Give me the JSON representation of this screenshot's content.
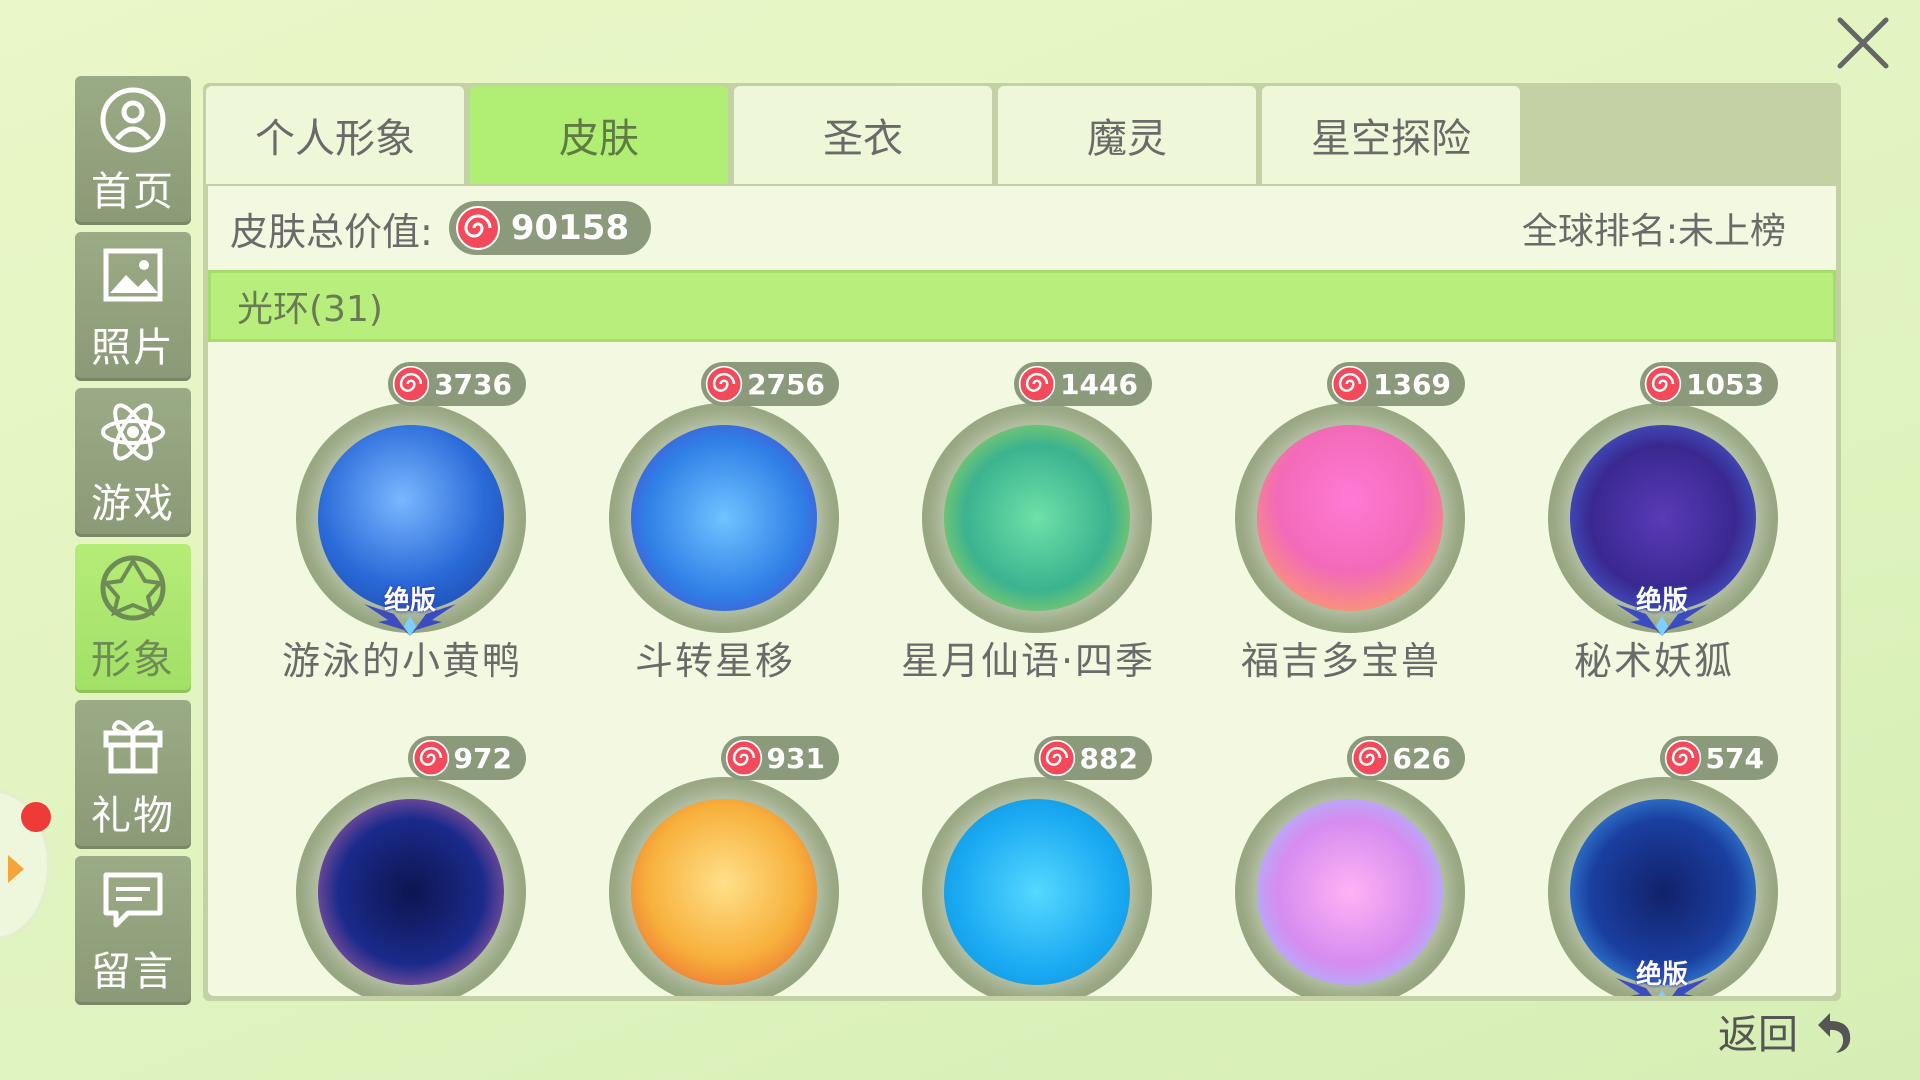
{
  "sidebar": {
    "items": [
      {
        "label": "首页",
        "icon": "user-icon"
      },
      {
        "label": "照片",
        "icon": "photo-icon"
      },
      {
        "label": "游戏",
        "icon": "atom-icon"
      },
      {
        "label": "形象",
        "icon": "avatar-star-icon",
        "active": true
      },
      {
        "label": "礼物",
        "icon": "gift-icon"
      },
      {
        "label": "留言",
        "icon": "message-icon"
      }
    ]
  },
  "tabs": [
    {
      "label": "个人形象"
    },
    {
      "label": "皮肤",
      "active": true
    },
    {
      "label": "圣衣"
    },
    {
      "label": "魔灵"
    },
    {
      "label": "星空探险"
    }
  ],
  "summary": {
    "total_label": "皮肤总价值:",
    "total_value": "90158",
    "rank_text": "全球排名:未上榜"
  },
  "category": {
    "label": "光环(31)"
  },
  "items": [
    {
      "name": "游泳的小黄鸭",
      "price": "3736",
      "badge": "绝版"
    },
    {
      "name": "斗转星移",
      "price": "2756"
    },
    {
      "name": "星月仙语·四季",
      "price": "1446"
    },
    {
      "name": "福吉多宝兽",
      "price": "1369"
    },
    {
      "name": "秘术妖狐",
      "price": "1053",
      "badge": "绝版"
    },
    {
      "name": "",
      "price": "972"
    },
    {
      "name": "",
      "price": "931"
    },
    {
      "name": "",
      "price": "882"
    },
    {
      "name": "",
      "price": "626"
    },
    {
      "name": "",
      "price": "574",
      "badge": "绝版"
    }
  ],
  "footer": {
    "back_label": "返回"
  },
  "colors": {
    "accent_green": "#b1ee74",
    "pill_gray": "#8a9a7a",
    "sidebar_gray": "#9aab86",
    "notification_red": "#ee3b37"
  }
}
